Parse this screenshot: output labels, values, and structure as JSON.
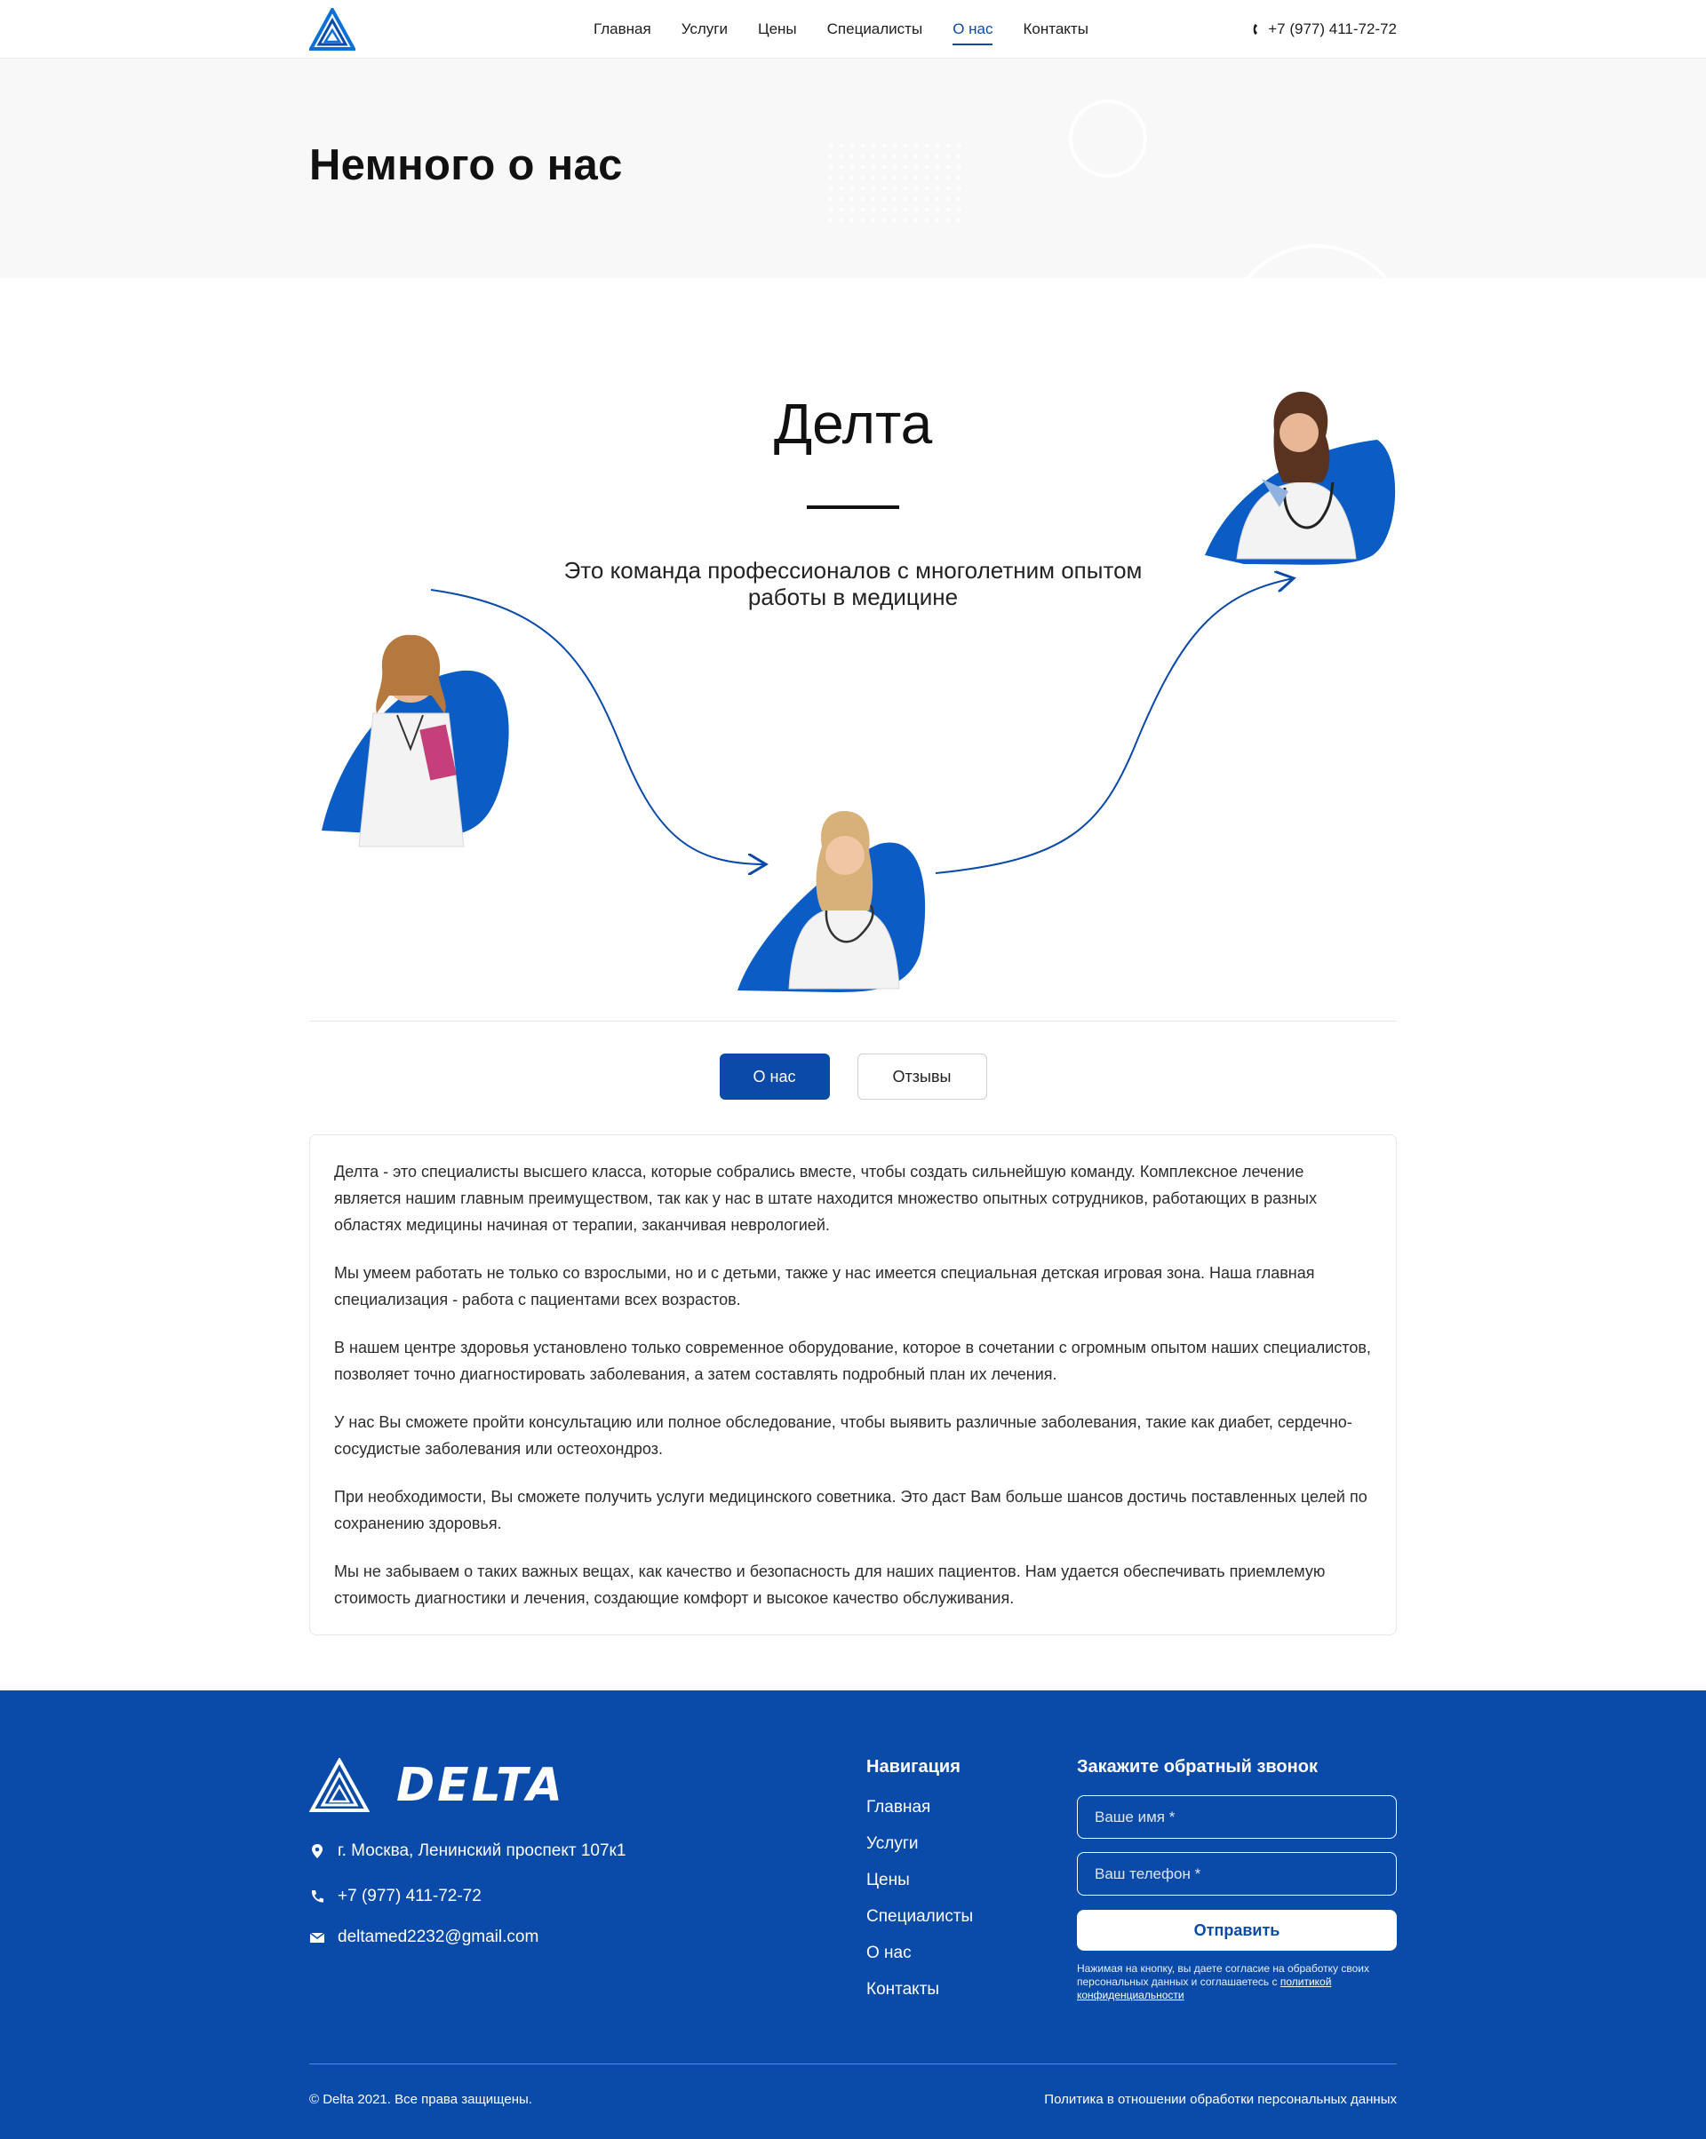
{
  "header": {
    "nav": [
      "Главная",
      "Услуги",
      "Цены",
      "Специалисты",
      "О нас",
      "Контакты"
    ],
    "active_nav": "О нас",
    "phone": "+7 (977) 411-72-72"
  },
  "hero": {
    "title": "Немного о нас"
  },
  "scheme": {
    "title": "Делта",
    "subtitle": "Это команда профессионалов с многолетним опытом работы в медицине"
  },
  "tabs": {
    "about": "О нас",
    "reviews": "Отзывы"
  },
  "about_text": [
    "Делта - это специалисты высшего класса, которые собрались вместе, чтобы создать сильнейшую команду. Комплексное лечение является нашим главным преимуществом, так как у нас в штате находится множество опытных сотрудников, работающих в разных областях медицины начиная от терапии, заканчивая неврологией.",
    "Мы умеем работать не только со взрослыми, но и с детьми, также у нас имеется специальная детская игровая зона. Наша главная специализация - работа с пациентами всех возрастов.",
    "В нашем центре здоровья установлено только современное оборудование, которое в сочетании с огромным опытом наших специалистов, позволяет точно диагностировать заболевания, а затем составлять подробный план их лечения.",
    "У нас Вы сможете пройти консультацию или полное обследование, чтобы выявить различные заболевания, такие как диабет, сердечно-сосудистые заболевания или остеохондроз.",
    "При необходимости, Вы сможете получить услуги медицинского советника. Это даст Вам больше шансов достичь поставленных целей по сохранению здоровья.",
    "Мы не забываем о таких важных вещах, как качество и безопасность для наших пациентов. Нам удается обеспечивать приемлемую стоимость диагностики и лечения, создающие комфорт и высокое качество обслуживания."
  ],
  "footer": {
    "brand": "DELTA",
    "address": "г. Москва, Ленинский проспект 107к1",
    "phone": "+7 (977) 411-72-72",
    "email": "deltamed2232@gmail.com",
    "nav_title": "Навигация",
    "nav": [
      "Главная",
      "Услуги",
      "Цены",
      "Специалисты",
      "О нас",
      "Контакты"
    ],
    "form_title": "Закажите обратный звонок",
    "name_placeholder": "Ваше имя *",
    "phone_placeholder": "Ваш телефон *",
    "submit": "Отправить",
    "consent_text": "Нажимая на кнопку, вы даете согласие на обработку своих персональных данных и соглашаетесь с",
    "consent_link": "политикой конфиденциальности",
    "copyright": "© Delta 2021. Все права защищены.",
    "policy": "Политика в отношении обработки персональных данных"
  },
  "colors": {
    "brand_blue": "#0b4aa8",
    "footer_blue": "#0a4aa8",
    "band_gray": "#f8f8f8"
  }
}
